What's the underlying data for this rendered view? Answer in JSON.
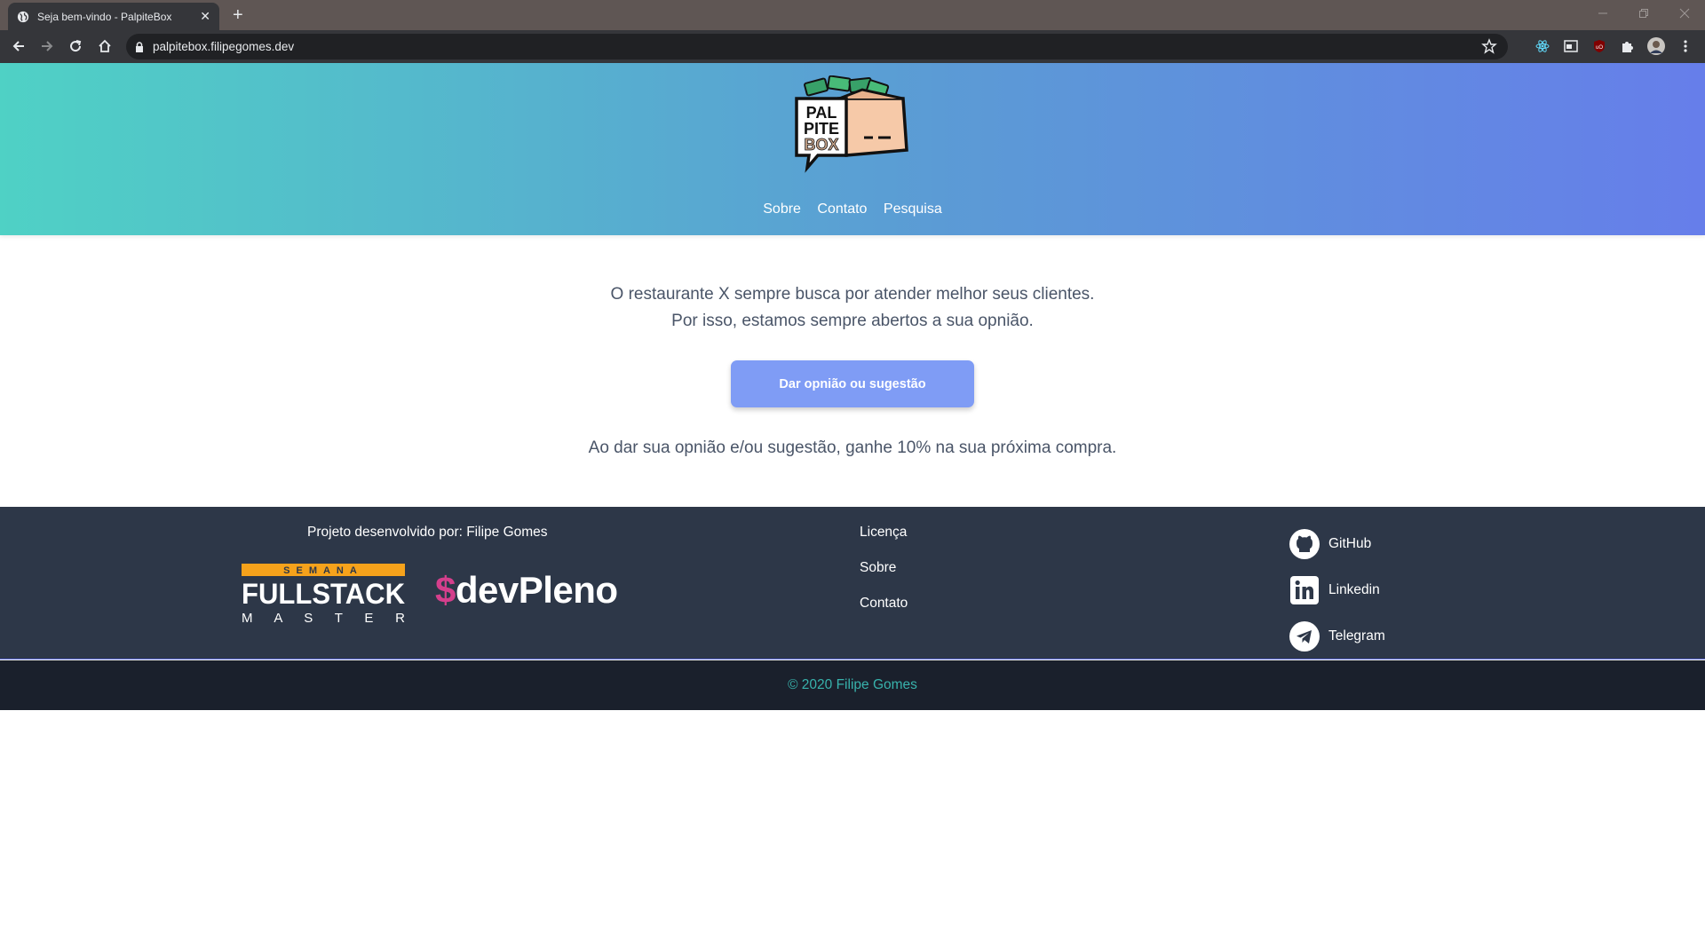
{
  "browser": {
    "tab_title": "Seja bem-vindo - PalpiteBox",
    "tab_close": "✕",
    "new_tab": "+",
    "url": "palpitebox.filipegomes.dev"
  },
  "header": {
    "logo": {
      "line1": "PAL",
      "line2": "PITE",
      "line3": "BOX"
    },
    "nav": [
      "Sobre",
      "Contato",
      "Pesquisa"
    ]
  },
  "main": {
    "line1": "O restaurante X sempre busca por atender melhor seus clientes.",
    "line2": "Por isso, estamos sempre abertos a sua opnião.",
    "cta_label": "Dar opnião ou sugestão",
    "bonus_text": "Ao dar sua opnião e/ou sugestão, ganhe 10% na sua próxima compra."
  },
  "footer": {
    "credit": "Projeto desenvolvido por: Filipe Gomes",
    "fsm": {
      "top": "SEMANA",
      "mid": "FULLSTACK",
      "bottom": "M A S T E R"
    },
    "devpleno": {
      "dollar": "$",
      "text": "devPleno"
    },
    "links": [
      "Licença",
      "Sobre",
      "Contato"
    ],
    "social": [
      "GitHub",
      "Linkedin",
      "Telegram"
    ],
    "copyright": "© 2020 Filipe Gomes"
  },
  "colors": {
    "gradient_start": "#4fd1c5",
    "gradient_end": "#667eea",
    "cta": "#7f9cf5",
    "footer": "#2d3748",
    "copyright_bar": "#1a202c",
    "copyright_text": "#38b2ac",
    "devpleno_dollar": "#d53f8c",
    "fsm_orange": "#f6a21b"
  },
  "icons": [
    "globe-icon",
    "back-icon",
    "forward-icon",
    "reload-icon",
    "home-icon",
    "lock-icon",
    "star-icon",
    "react-devtools-icon",
    "tab-icon",
    "ublock-icon",
    "puzzle-icon",
    "profile-avatar",
    "menu-icon",
    "github-icon",
    "linkedin-icon",
    "telegram-icon"
  ]
}
